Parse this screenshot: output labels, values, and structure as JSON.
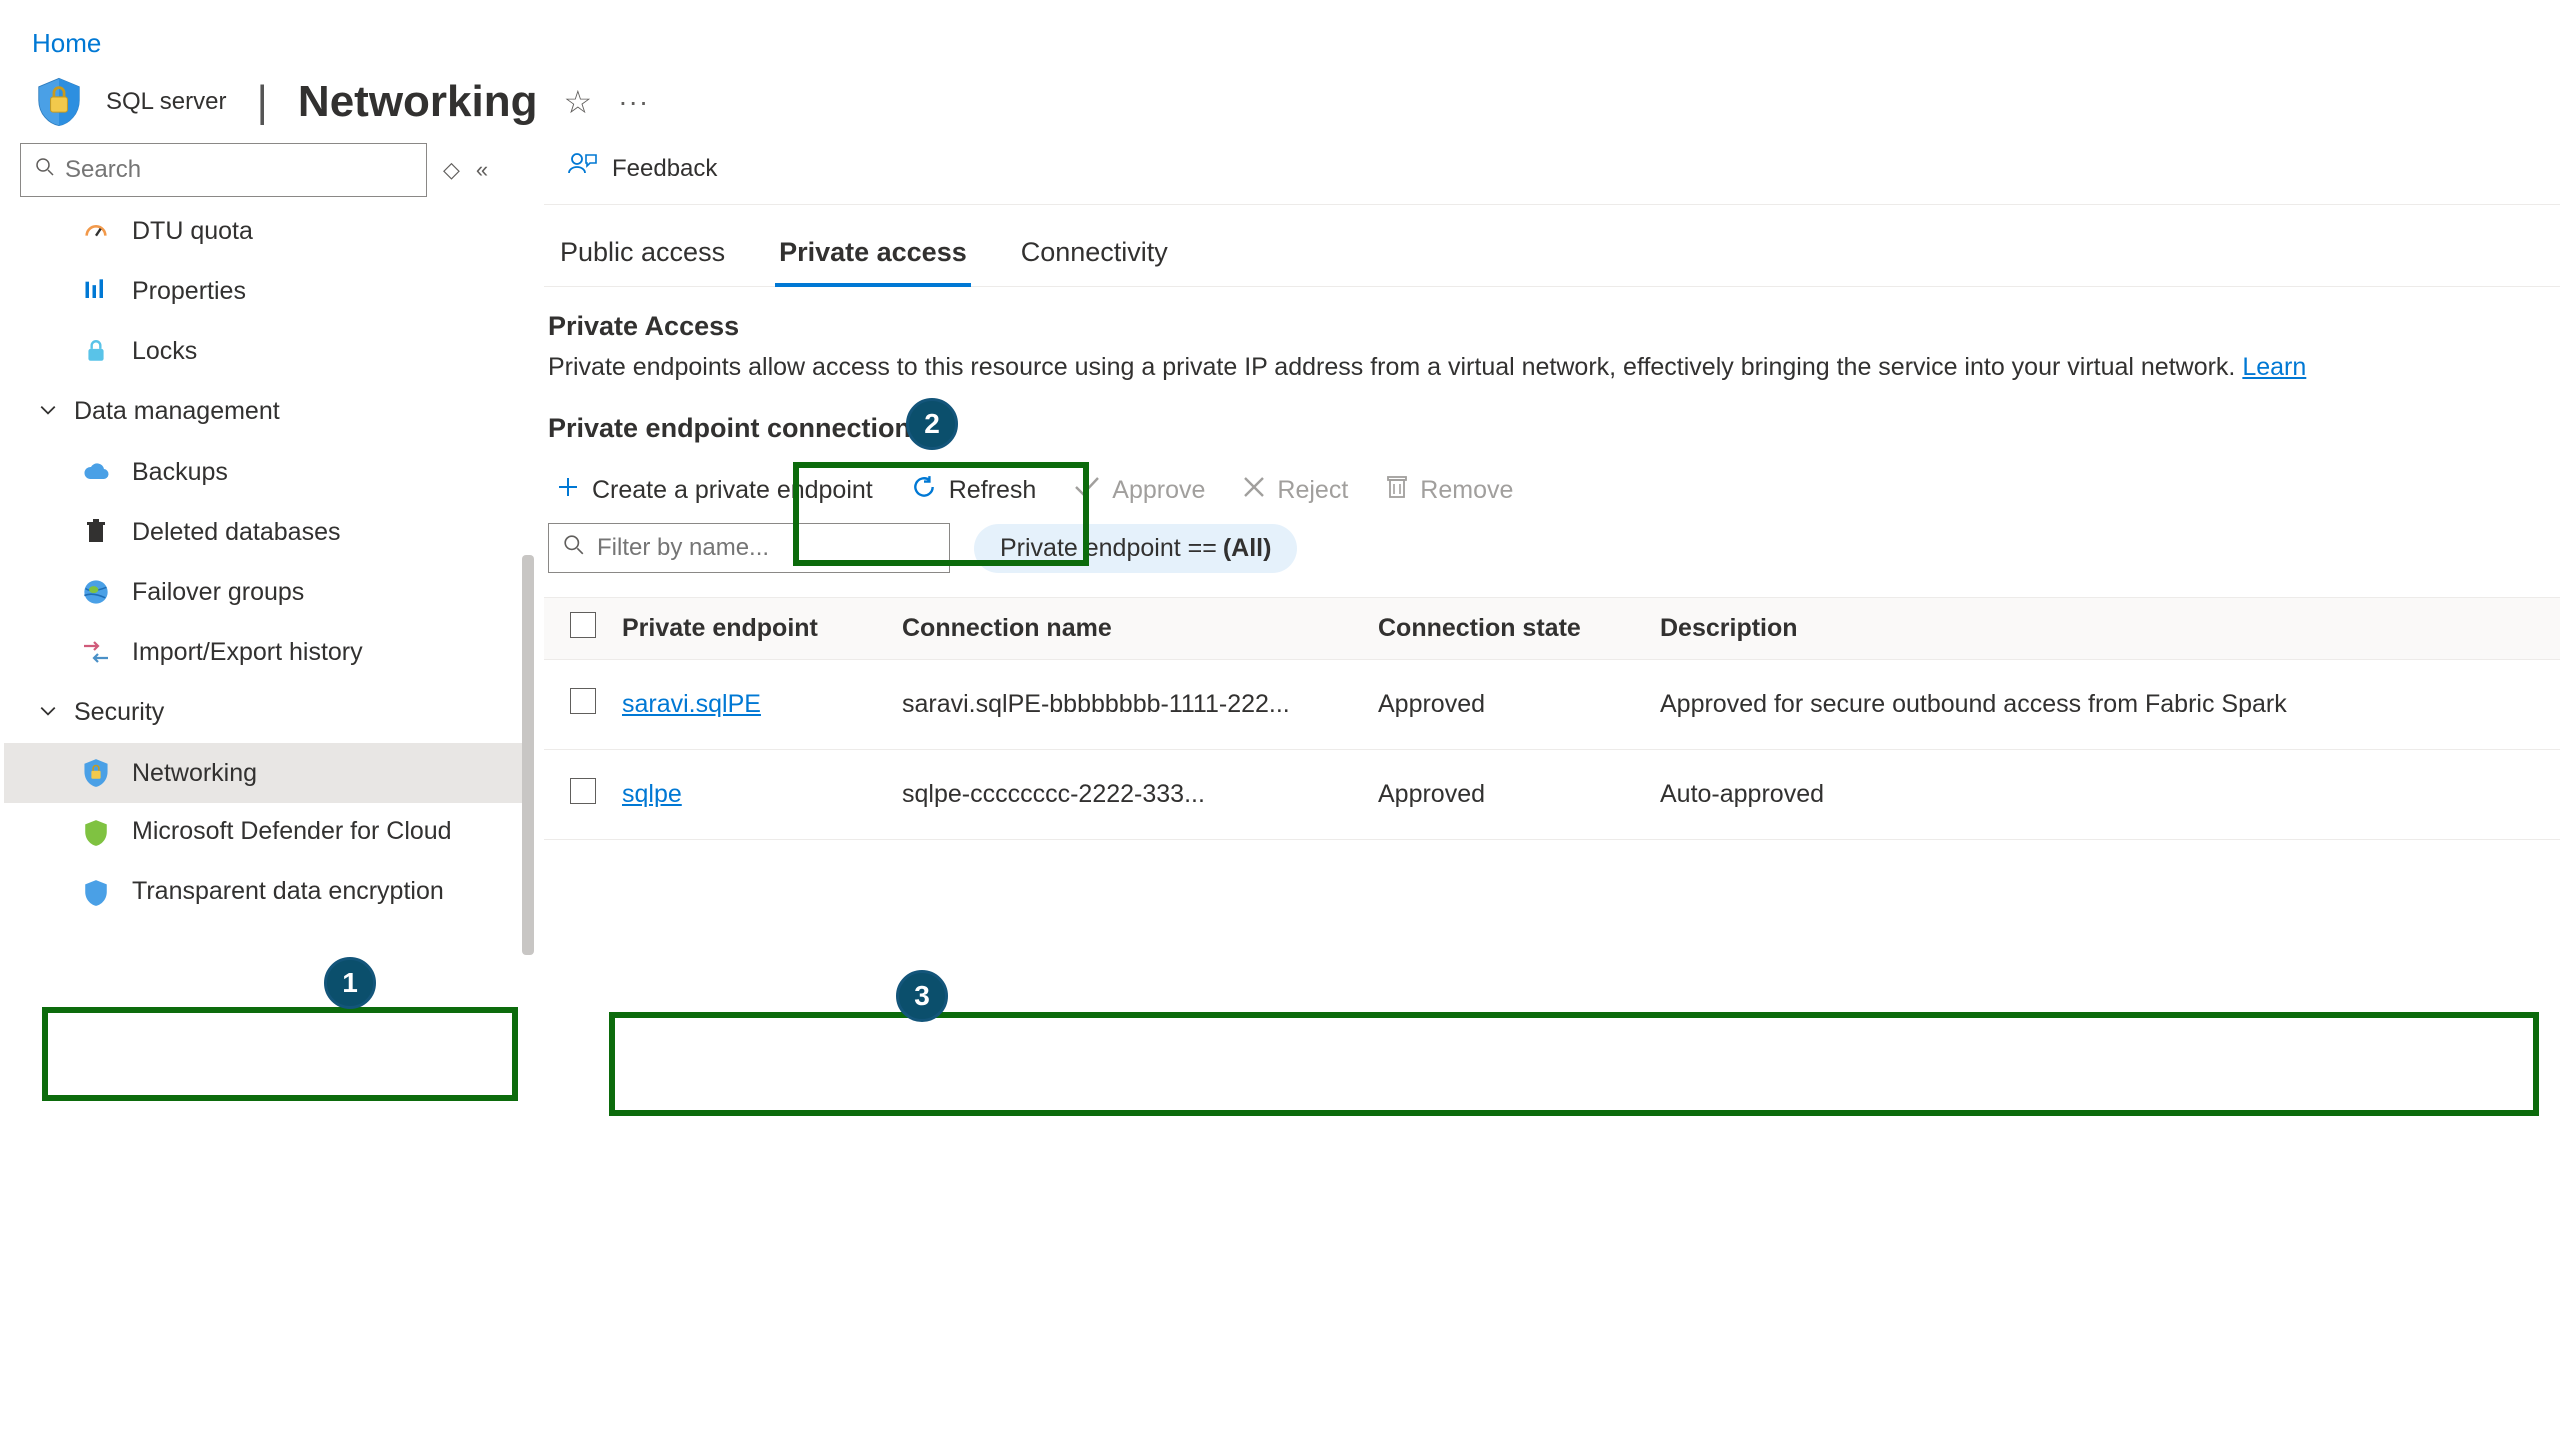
{
  "breadcrumb": {
    "home": "Home"
  },
  "header": {
    "separator": "|",
    "title": "Networking",
    "subtitle": "SQL server"
  },
  "sidebar": {
    "search_placeholder": "Search",
    "items": {
      "dtu": "DTU quota",
      "properties": "Properties",
      "locks": "Locks",
      "data_management": "Data management",
      "backups": "Backups",
      "deleted_databases": "Deleted databases",
      "failover_groups": "Failover groups",
      "import_export": "Import/Export history",
      "security": "Security",
      "networking": "Networking",
      "defender": "Microsoft Defender for Cloud",
      "tde": "Transparent data encryption"
    }
  },
  "main": {
    "feedback": "Feedback",
    "tabs": {
      "public": "Public access",
      "private": "Private access",
      "connectivity": "Connectivity"
    },
    "section": {
      "title": "Private Access",
      "text": "Private endpoints allow access to this resource using a private IP address from a virtual network, effectively bringing the service into your virtual network.",
      "learn": "Learn",
      "connections": "Private endpoint connections"
    },
    "actions": {
      "create": "Create a private endpoint",
      "refresh": "Refresh",
      "approve": "Approve",
      "reject": "Reject",
      "remove": "Remove"
    },
    "filter": {
      "placeholder": "Filter by name...",
      "pill_prefix": "Private endpoint ==",
      "pill_value": "(All)"
    },
    "table": {
      "headers": {
        "pe": "Private endpoint",
        "cn": "Connection name",
        "cs": "Connection state",
        "desc": "Description"
      },
      "rows": [
        {
          "pe": "saravi.sqlPE",
          "cn": "saravi.sqlPE-bbbbbbbb-1111-222...",
          "cs": "Approved",
          "desc": "Approved for secure outbound access from Fabric Spark"
        },
        {
          "pe": "sqlpe",
          "cn": "sqlpe-cccccccc-2222-333...",
          "cs": "Approved",
          "desc": "Auto-approved"
        }
      ]
    }
  },
  "annotations": {
    "a1": "1",
    "a2": "2",
    "a3": "3"
  }
}
